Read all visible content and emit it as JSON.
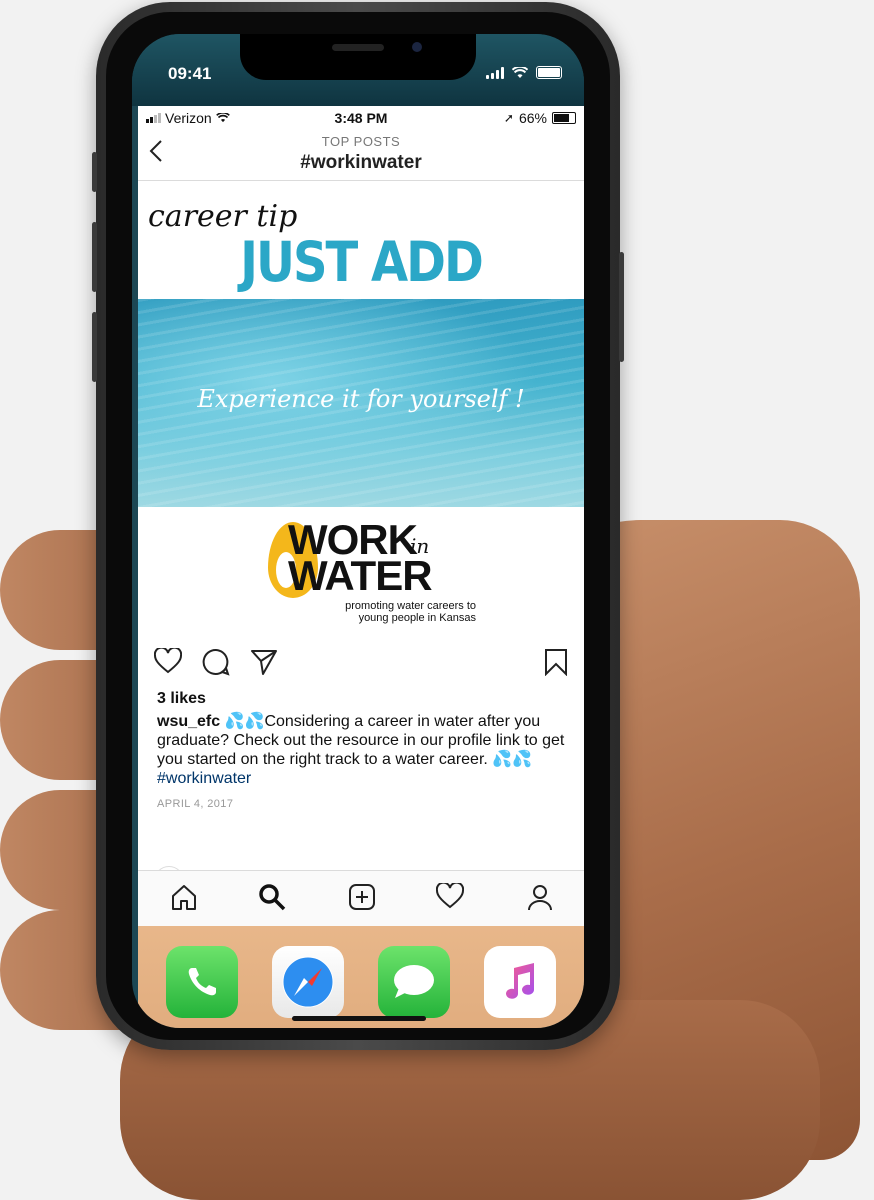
{
  "outer_status": {
    "time": "09:41"
  },
  "ig_status": {
    "carrier": "Verizon",
    "time": "3:48 PM",
    "battery": "66%"
  },
  "header": {
    "subtitle": "TOP POSTS",
    "title": "#workinwater"
  },
  "post_image": {
    "tip": "career tip",
    "headline": "JUST ADD WATER",
    "tagline": "Experience it for yourself !",
    "logo_line1": "WORK",
    "logo_in": "in",
    "logo_line2": "WATER",
    "logo_tagline": "promoting water careers to young people in Kansas"
  },
  "post": {
    "likes": "3 likes",
    "username": "wsu_efc",
    "emoji": "💦💦",
    "caption": "Considering a career in water after you graduate? Check out the resource in our profile link to get you started on the right track to a water career.",
    "emoji_end": "💦💦",
    "hashtag": "#workinwater",
    "date": "APRIL 4, 2017"
  },
  "icons": {
    "back": "back-chevron-icon",
    "like": "heart-icon",
    "comment": "comment-icon",
    "share": "paper-plane-icon",
    "save": "bookmark-icon",
    "tabs": [
      "home-icon",
      "search-icon",
      "add-post-icon",
      "activity-heart-icon",
      "profile-icon"
    ],
    "dock": [
      "phone-app-icon",
      "safari-app-icon",
      "messages-app-icon",
      "music-app-icon"
    ]
  },
  "colors": {
    "headline": "#2ba7c7",
    "hashtag": "#003569",
    "dock": "#e1ad7f",
    "logo_drop": "#f4b71b"
  }
}
